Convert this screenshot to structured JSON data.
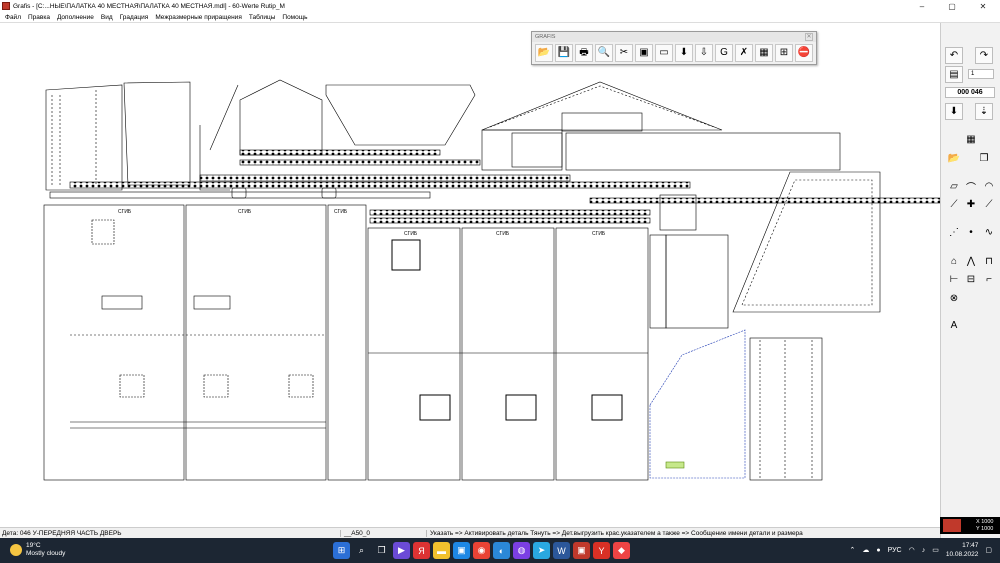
{
  "window": {
    "title": "Grafis - [C:...НЫЕ\\ПАЛАТКА 40 МЕСТНАЯ\\ПАЛАТКА 40 МЕСТНАЯ.mdl] - 60-Werte Rutip_M",
    "controls": [
      "–",
      "▢",
      "✕"
    ]
  },
  "menu": [
    "Файл",
    "Правка",
    "Дополнение",
    "Вид",
    "Градация",
    "Межразмерные приращения",
    "Таблицы",
    "Помощь"
  ],
  "toolbar": {
    "title": "GRAFIS",
    "close": "✕",
    "buttons": [
      {
        "name": "open-folder-icon",
        "glyph": "📂"
      },
      {
        "name": "save-icon",
        "glyph": "💾"
      },
      {
        "name": "print-icon",
        "glyph": "🖶"
      },
      {
        "name": "zoom-icon",
        "glyph": "🔍"
      },
      {
        "name": "cut-icon",
        "glyph": "✂"
      },
      {
        "name": "piece-icon",
        "glyph": "▣"
      },
      {
        "name": "ruler-icon",
        "glyph": "▭"
      },
      {
        "name": "download-icon",
        "glyph": "⬇"
      },
      {
        "name": "export-icon",
        "glyph": "⇩"
      },
      {
        "name": "grade-icon",
        "glyph": "G"
      },
      {
        "name": "cross-icon",
        "glyph": "✗"
      },
      {
        "name": "table-icon",
        "glyph": "▦"
      },
      {
        "name": "layout-icon",
        "glyph": "⊞"
      },
      {
        "name": "stop-icon",
        "glyph": "⛔"
      }
    ]
  },
  "drawing": {
    "labels": {
      "sgib": "СГИБ"
    }
  },
  "right_panel": {
    "counter": "000 046",
    "input_value": "1"
  },
  "coords": {
    "x": "X 1000",
    "y": "Y 1000"
  },
  "status": {
    "piece": "Дета: 046  У-ПЕРЕДНЯЯ ЧАСТЬ ДВЕРЬ",
    "size": "__A50_0",
    "hint": "Указать => Активировать деталь Тянуть => Дет.выгрузить крас.указателем а также => Сообщение имени детали и размера"
  },
  "taskbar": {
    "temp": "19°C",
    "weather": "Mostly cloudy",
    "lang": "РУС",
    "time": "17:47",
    "date": "10.08.2022"
  }
}
